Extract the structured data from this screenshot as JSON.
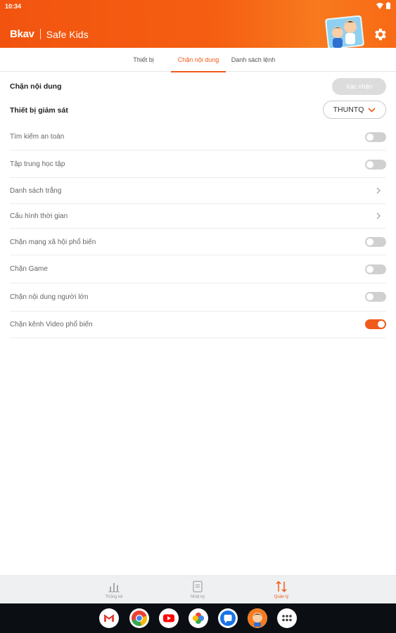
{
  "status_bar": {
    "time": "10:34"
  },
  "app": {
    "brand": "Bkav",
    "title": "Safe Kids"
  },
  "tabs": [
    {
      "label": "Thiết bị",
      "active": false
    },
    {
      "label": "Chặn nội dung",
      "active": true
    },
    {
      "label": "Danh sách lệnh",
      "active": false
    }
  ],
  "content_block": {
    "title": "Chặn nội dung",
    "confirm_label": "Xác nhận",
    "device_label": "Thiết bị giám sát",
    "device_selected": "THUNTQ"
  },
  "settings": [
    {
      "label": "Tìm kiếm an toàn",
      "control": "toggle",
      "enabled": false
    },
    {
      "label": "Tập trung học tập",
      "control": "toggle",
      "enabled": false
    },
    {
      "label": "Danh sách trắng",
      "control": "chevron"
    },
    {
      "label": "Cấu hình thời gian",
      "control": "chevron"
    },
    {
      "label": "Chặn mạng xã hội phổ biến",
      "control": "toggle",
      "enabled": false
    },
    {
      "label": "Chặn Game",
      "control": "toggle",
      "enabled": false
    },
    {
      "label": "Chặn nội dung người lớn",
      "control": "toggle",
      "enabled": false
    },
    {
      "label": "Chặn kênh Video phổ biến",
      "control": "toggle",
      "enabled": true
    }
  ],
  "bottom_nav": [
    {
      "label": "Thống kê",
      "icon": "bar-chart-icon",
      "active": false
    },
    {
      "label": "Nhật ký",
      "icon": "journal-icon",
      "active": false
    },
    {
      "label": "Quản lý",
      "icon": "sliders-icon",
      "active": true
    }
  ],
  "dock_apps": [
    "gmail-icon",
    "chrome-icon",
    "youtube-icon",
    "photos-icon",
    "messages-icon",
    "safe-kids-icon",
    "app-drawer-icon"
  ],
  "colors": {
    "accent": "#f05a1a",
    "header": "#f55f12",
    "toggle_off": "#d0d0d0"
  }
}
